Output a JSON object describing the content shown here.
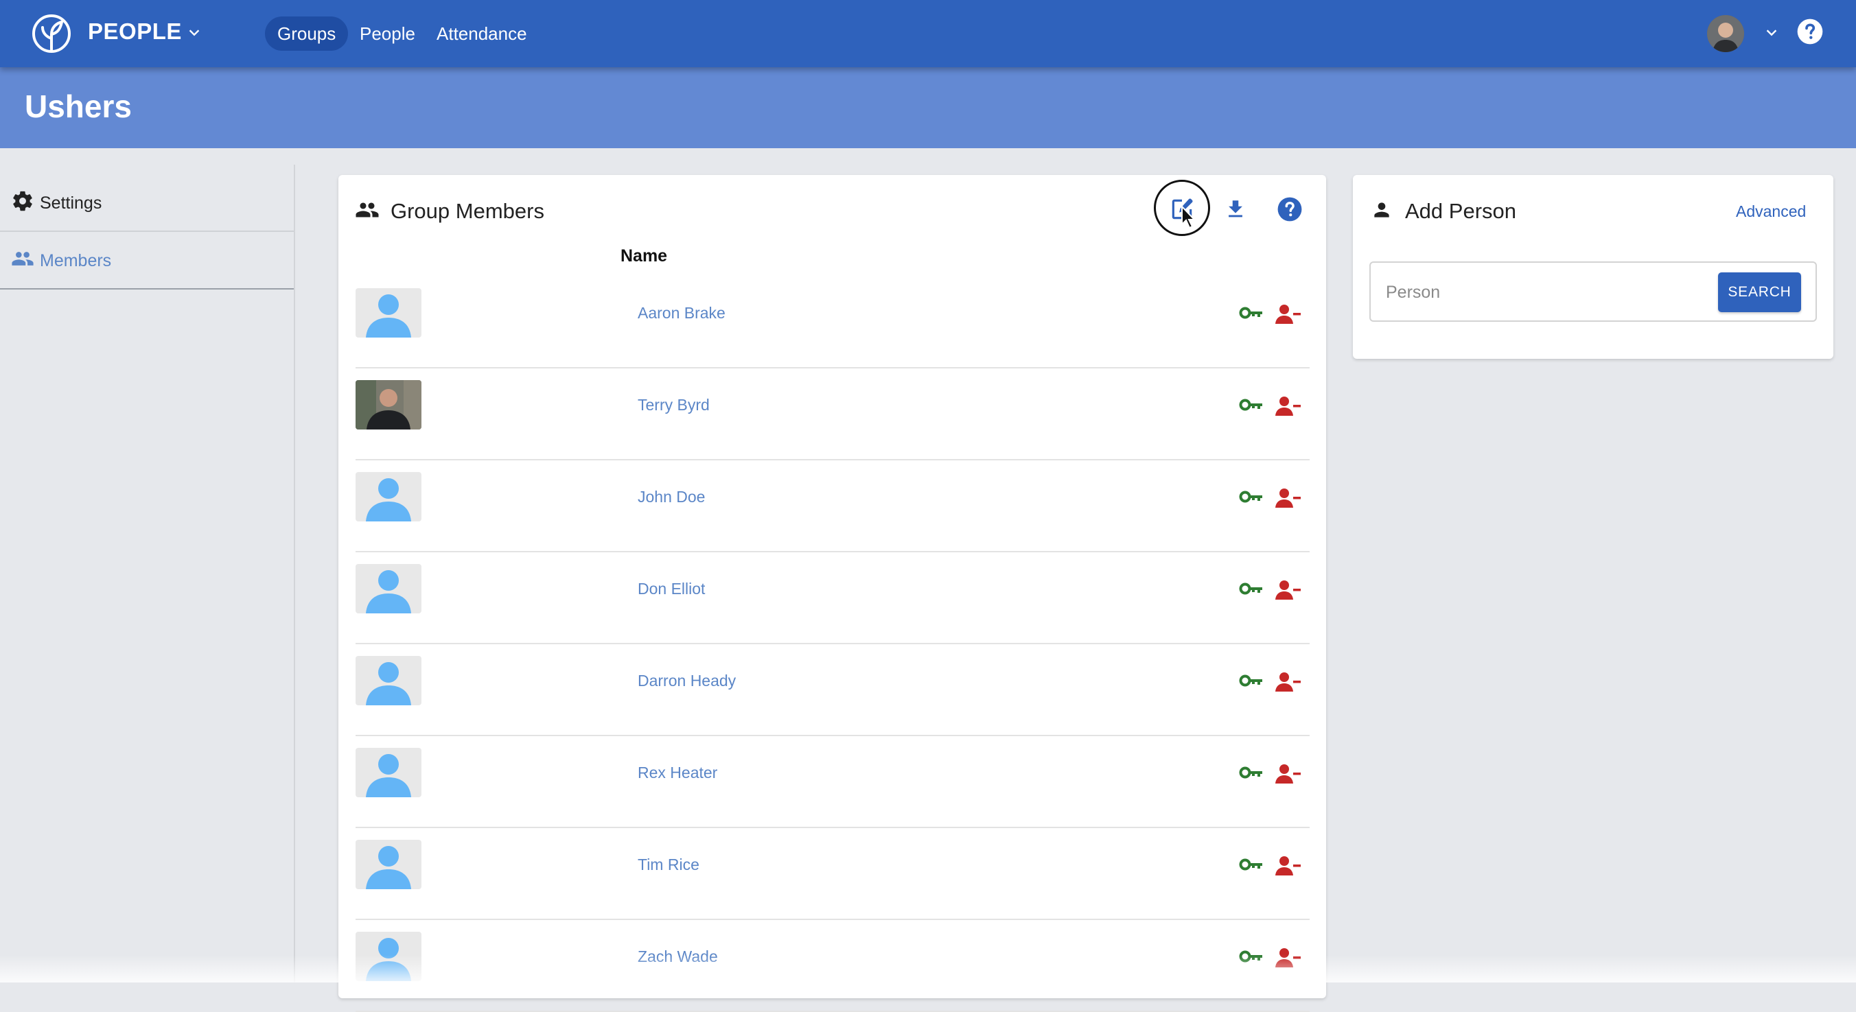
{
  "app": {
    "name": "PEOPLE"
  },
  "nav": {
    "items": [
      {
        "label": "Groups"
      },
      {
        "label": "People"
      },
      {
        "label": "Attendance"
      }
    ]
  },
  "page": {
    "title": "Ushers"
  },
  "sidebar": {
    "items": [
      {
        "label": "Settings",
        "icon": "gear-icon"
      },
      {
        "label": "Members",
        "icon": "people-icon"
      }
    ]
  },
  "group_members": {
    "title": "Group Members",
    "column_name": "Name",
    "members": [
      {
        "name": "Aaron Brake",
        "photo": "placeholder"
      },
      {
        "name": "Terry Byrd",
        "photo": "photo"
      },
      {
        "name": "John Doe",
        "photo": "placeholder"
      },
      {
        "name": "Don Elliot",
        "photo": "placeholder"
      },
      {
        "name": "Darron Heady",
        "photo": "placeholder"
      },
      {
        "name": "Rex Heater",
        "photo": "placeholder"
      },
      {
        "name": "Tim Rice",
        "photo": "placeholder"
      },
      {
        "name": "Zach Wade",
        "photo": "placeholder"
      }
    ]
  },
  "add_person": {
    "title": "Add Person",
    "advanced_label": "Advanced",
    "search_placeholder": "Person",
    "search_button": "SEARCH"
  },
  "colors": {
    "topbar": "#2f62bc",
    "page_header": "#6389d3",
    "link": "#5b86c7",
    "key_icon": "#2e7d32",
    "remove_icon": "#c62828",
    "avatar_placeholder": "#64b5f6"
  }
}
